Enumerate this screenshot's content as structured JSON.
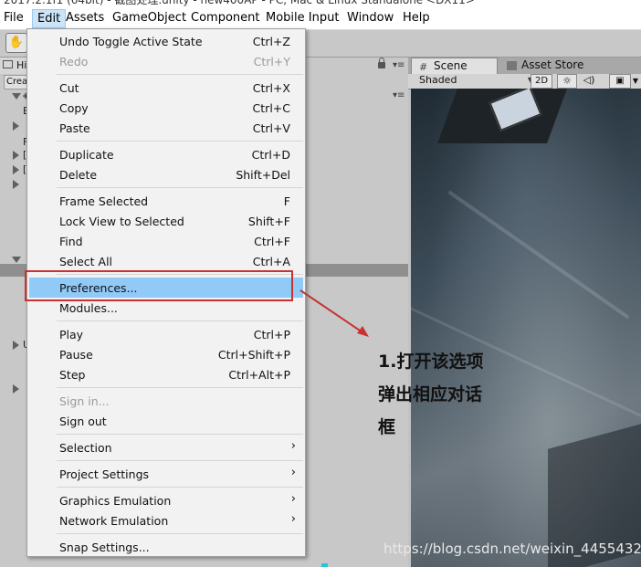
{
  "window": {
    "title": "2017.2.1f1 (64bit) - 截图处理.unity - new400AP - PC, Mac & Linux Standalone <DX11>"
  },
  "menubar": {
    "items": [
      {
        "label": "File"
      },
      {
        "label": "Edit",
        "active": true
      },
      {
        "label": "Assets"
      },
      {
        "label": "GameObject"
      },
      {
        "label": "Component"
      },
      {
        "label": "Mobile Input"
      },
      {
        "label": "Window"
      },
      {
        "label": "Help"
      }
    ]
  },
  "hierarchy": {
    "tab_label": "Hi",
    "create_label": "Crea",
    "rows": [
      "E",
      "",
      "F",
      "[",
      "[",
      "",
      "",
      " F",
      "D",
      "C",
      "",
      "",
      "",
      "",
      "",
      "U",
      "t",
      "I",
      "",
      "s"
    ]
  },
  "scene": {
    "tabs": [
      {
        "label": "Scene",
        "icon": "grid-icon"
      },
      {
        "label": "Asset Store",
        "icon": "store-icon"
      }
    ],
    "shading_mode": "Shaded",
    "mode_2d_label": "2D"
  },
  "edit_menu": {
    "items": [
      {
        "label": "Undo Toggle Active State",
        "shortcut": "Ctrl+Z"
      },
      {
        "label": "Redo",
        "shortcut": "Ctrl+Y",
        "disabled": true
      },
      {
        "label": "Cut",
        "shortcut": "Ctrl+X"
      },
      {
        "label": "Copy",
        "shortcut": "Ctrl+C"
      },
      {
        "label": "Paste",
        "shortcut": "Ctrl+V"
      },
      {
        "label": "Duplicate",
        "shortcut": "Ctrl+D"
      },
      {
        "label": "Delete",
        "shortcut": "Shift+Del"
      },
      {
        "label": "Frame Selected",
        "shortcut": "F"
      },
      {
        "label": "Lock View to Selected",
        "shortcut": "Shift+F"
      },
      {
        "label": "Find",
        "shortcut": "Ctrl+F"
      },
      {
        "label": "Select All",
        "shortcut": "Ctrl+A"
      },
      {
        "label": "Preferences...",
        "shortcut": "",
        "highlighted": true
      },
      {
        "label": "Modules...",
        "shortcut": ""
      },
      {
        "label": "Play",
        "shortcut": "Ctrl+P"
      },
      {
        "label": "Pause",
        "shortcut": "Ctrl+Shift+P"
      },
      {
        "label": "Step",
        "shortcut": "Ctrl+Alt+P"
      },
      {
        "label": "Sign in...",
        "shortcut": "",
        "disabled": true
      },
      {
        "label": "Sign out",
        "shortcut": ""
      },
      {
        "label": "Selection",
        "shortcut": "",
        "submenu": true
      },
      {
        "label": "Project Settings",
        "shortcut": "",
        "submenu": true
      },
      {
        "label": "Graphics Emulation",
        "shortcut": "",
        "submenu": true
      },
      {
        "label": "Network Emulation",
        "shortcut": "",
        "submenu": true
      },
      {
        "label": "Snap Settings...",
        "shortcut": ""
      }
    ]
  },
  "annotation": {
    "lines": [
      "1.打开该选项",
      "弹出相应对话",
      "框"
    ],
    "color": "#c83232"
  },
  "watermark": "https://blog.csdn.net/weixin_44554329",
  "colors": {
    "highlight": "#91c9f7",
    "menu_bg": "#f2f2f2",
    "accent_red": "#c83232"
  }
}
